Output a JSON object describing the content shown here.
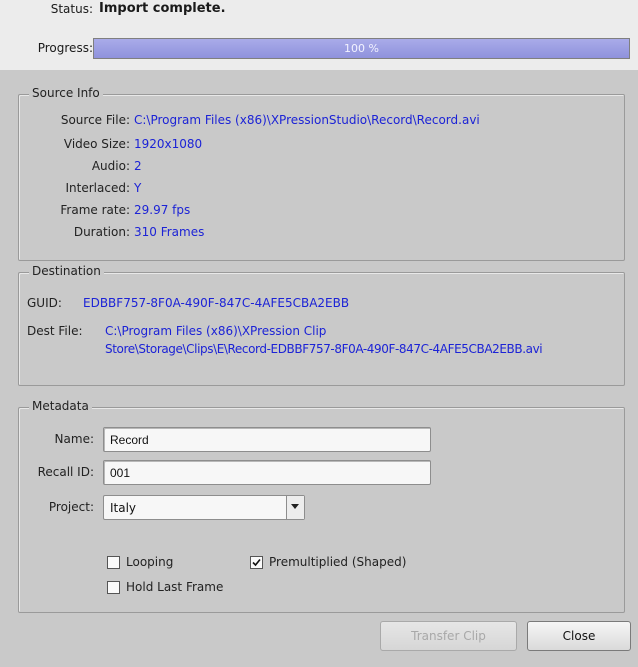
{
  "status": {
    "label": "Status:",
    "value": "Import complete."
  },
  "progress": {
    "label": "Progress:",
    "percent": 100,
    "text": "100 %"
  },
  "source_info": {
    "title": "Source Info",
    "rows": [
      {
        "label": "Source File:",
        "value": "C:\\Program Files (x86)\\XPressionStudio\\Record\\Record.avi"
      },
      {
        "label": "Video Size:",
        "value": "1920x1080"
      },
      {
        "label": "Audio:",
        "value": "2"
      },
      {
        "label": "Interlaced:",
        "value": "Y"
      },
      {
        "label": "Frame rate:",
        "value": "29.97 fps"
      },
      {
        "label": "Duration:",
        "value": "310 Frames"
      }
    ]
  },
  "destination": {
    "title": "Destination",
    "guid_label": "GUID:",
    "guid": "EDBBF757-8F0A-490F-847C-4AFE5CBA2EBB",
    "dest_file_label": "Dest File:",
    "dest_file_line1": "C:\\Program Files (x86)\\XPression Clip",
    "dest_file_line2": "Store\\Storage\\Clips\\E\\Record-EDBBF757-8F0A-490F-847C-4AFE5CBA2EBB.avi"
  },
  "metadata": {
    "title": "Metadata",
    "name_label": "Name:",
    "name_value": "Record",
    "recall_label": "Recall ID:",
    "recall_value": "001",
    "project_label": "Project:",
    "project_value": "Italy",
    "looping_label": "Looping",
    "looping_checked": false,
    "premultiplied_label": "Premultiplied (Shaped)",
    "premultiplied_checked": true,
    "hold_label": "Hold Last Frame",
    "hold_checked": false
  },
  "buttons": {
    "transfer": "Transfer Clip",
    "close": "Close"
  }
}
